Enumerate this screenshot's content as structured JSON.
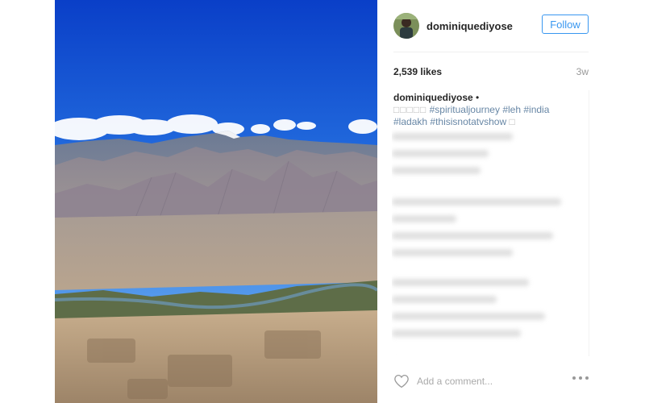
{
  "post": {
    "image_icon": "mountain-landscape-photo",
    "author": "dominiquediyose",
    "follow_label": "Follow",
    "likes": "2,539 likes",
    "age": "3w",
    "caption": {
      "author": "dominiquediyose",
      "bullet": "•",
      "emoji_placeholder": "□□□□□",
      "hashtags_line1": [
        "#spiritualjourney",
        "#leh",
        "#india"
      ],
      "hashtags_line2": [
        "#ladakh",
        "#thisisnotatvshow"
      ],
      "trailing_emoji": "□"
    },
    "comment_placeholder": "Add a comment...",
    "heart_icon": "heart-outline-icon",
    "more_icon": "more-options-icon"
  },
  "colors": {
    "accent": "#3897f0",
    "hashtag": "#003569",
    "muted": "#999999"
  }
}
